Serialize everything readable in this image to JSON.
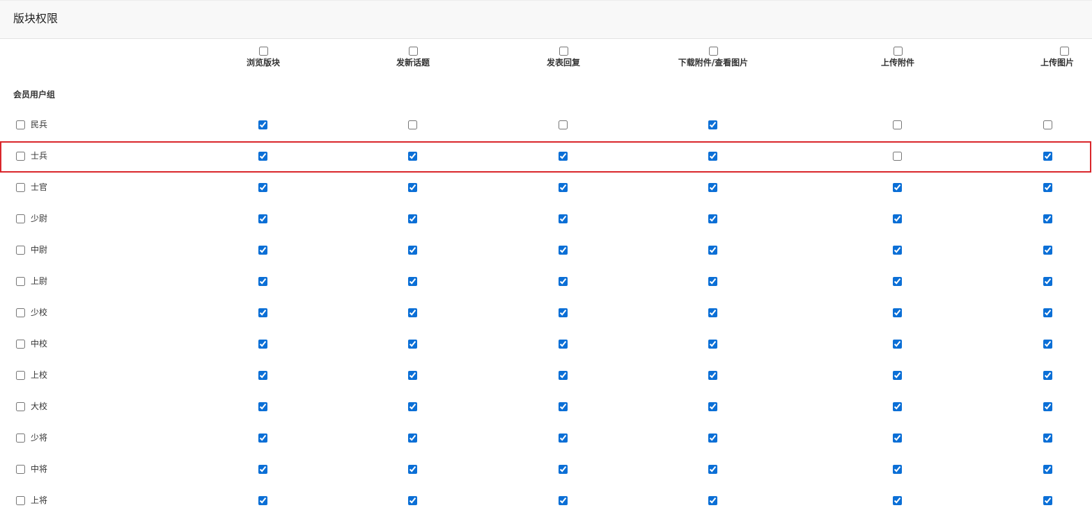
{
  "header": {
    "title": "版块权限"
  },
  "columns": [
    {
      "label": "浏览版块",
      "checked": false
    },
    {
      "label": "发新话题",
      "checked": false
    },
    {
      "label": "发表回复",
      "checked": false
    },
    {
      "label": "下载附件/查看图片",
      "checked": false
    },
    {
      "label": "上传附件",
      "checked": false
    },
    {
      "label": "上传图片",
      "checked": false
    }
  ],
  "group_label": "会员用户组",
  "highlight_color": "#d9262b",
  "accent_color": "#0b6fd6",
  "rows": [
    {
      "name": "民兵",
      "selected": false,
      "perms": [
        true,
        false,
        false,
        true,
        false,
        false
      ],
      "highlight": false
    },
    {
      "name": "士兵",
      "selected": false,
      "perms": [
        true,
        true,
        true,
        true,
        false,
        true
      ],
      "highlight": true
    },
    {
      "name": "士官",
      "selected": false,
      "perms": [
        true,
        true,
        true,
        true,
        true,
        true
      ],
      "highlight": false
    },
    {
      "name": "少尉",
      "selected": false,
      "perms": [
        true,
        true,
        true,
        true,
        true,
        true
      ],
      "highlight": false
    },
    {
      "name": "中尉",
      "selected": false,
      "perms": [
        true,
        true,
        true,
        true,
        true,
        true
      ],
      "highlight": false
    },
    {
      "name": "上尉",
      "selected": false,
      "perms": [
        true,
        true,
        true,
        true,
        true,
        true
      ],
      "highlight": false
    },
    {
      "name": "少校",
      "selected": false,
      "perms": [
        true,
        true,
        true,
        true,
        true,
        true
      ],
      "highlight": false
    },
    {
      "name": "中校",
      "selected": false,
      "perms": [
        true,
        true,
        true,
        true,
        true,
        true
      ],
      "highlight": false
    },
    {
      "name": "上校",
      "selected": false,
      "perms": [
        true,
        true,
        true,
        true,
        true,
        true
      ],
      "highlight": false
    },
    {
      "name": "大校",
      "selected": false,
      "perms": [
        true,
        true,
        true,
        true,
        true,
        true
      ],
      "highlight": false
    },
    {
      "name": "少将",
      "selected": false,
      "perms": [
        true,
        true,
        true,
        true,
        true,
        true
      ],
      "highlight": false
    },
    {
      "name": "中将",
      "selected": false,
      "perms": [
        true,
        true,
        true,
        true,
        true,
        true
      ],
      "highlight": false
    },
    {
      "name": "上将",
      "selected": false,
      "perms": [
        true,
        true,
        true,
        true,
        true,
        true
      ],
      "highlight": false
    }
  ]
}
